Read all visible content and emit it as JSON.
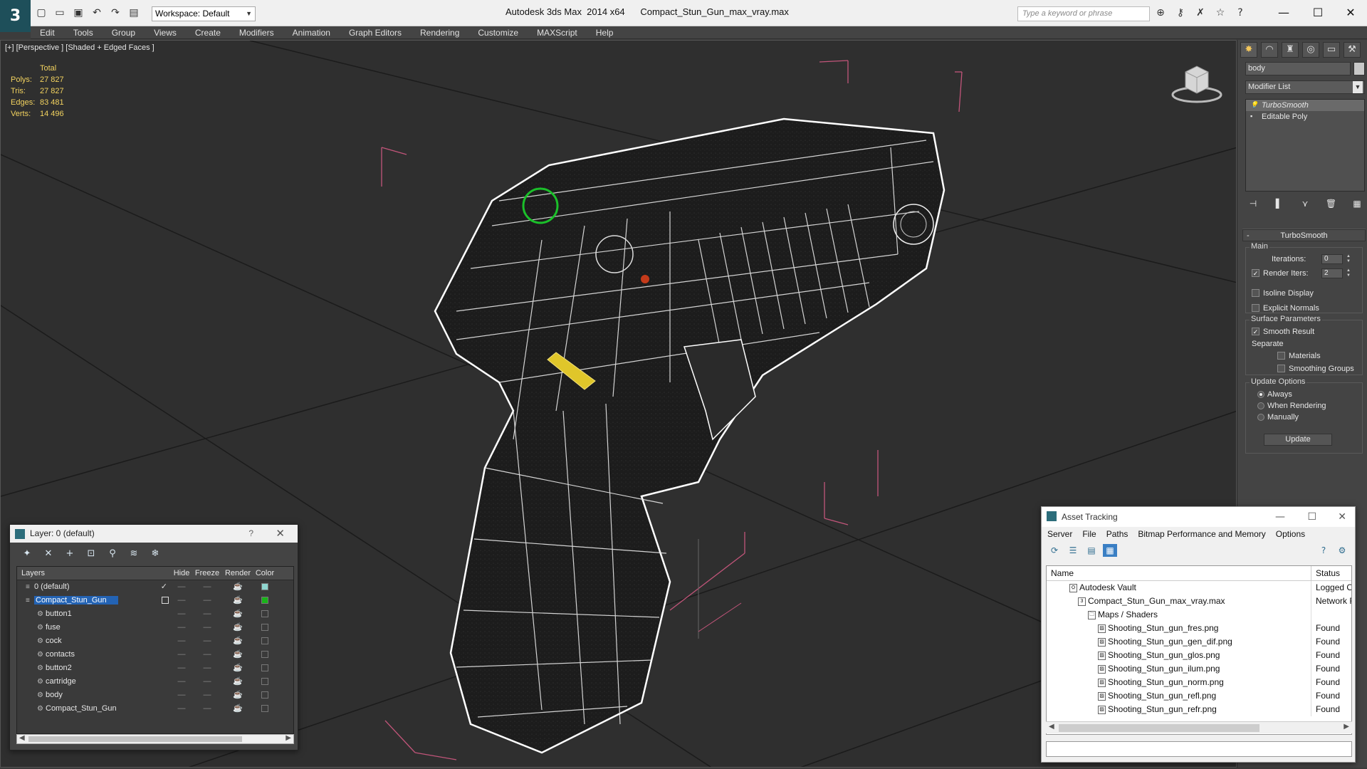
{
  "titlebar": {
    "workspace": "Workspace: Default",
    "app_title": "Autodesk 3ds Max  2014 x64      Compact_Stun_Gun_max_vray.max",
    "search_placeholder": "Type a keyword or phrase",
    "minimize": "—",
    "maximize": "☐",
    "close": "✕"
  },
  "menu": [
    "Edit",
    "Tools",
    "Group",
    "Views",
    "Create",
    "Modifiers",
    "Animation",
    "Graph Editors",
    "Rendering",
    "Customize",
    "MAXScript",
    "Help"
  ],
  "viewport": {
    "label": "[+] [Perspective ] [Shaded + Edged Faces ]",
    "stats_header": "Total",
    "stats": [
      {
        "k": "Polys:",
        "v": "27 827"
      },
      {
        "k": "Tris:",
        "v": "27 827"
      },
      {
        "k": "Edges:",
        "v": "83 481"
      },
      {
        "k": "Verts:",
        "v": "14 496"
      }
    ]
  },
  "command_panel": {
    "object_name": "body",
    "modifier_list": "Modifier List",
    "stack": [
      "TurboSmooth",
      "Editable Poly"
    ],
    "rollout_title": "TurboSmooth",
    "main_group": "Main",
    "iterations_label": "Iterations:",
    "iterations_value": "0",
    "render_iters_label": "Render Iters:",
    "render_iters_value": "2",
    "isoline": "Isoline Display",
    "explicit_normals": "Explicit Normals",
    "surface_group": "Surface Parameters",
    "smooth_result": "Smooth Result",
    "separate": "Separate",
    "materials": "Materials",
    "smoothing_groups": "Smoothing Groups",
    "update_group": "Update Options",
    "always": "Always",
    "when_rendering": "When Rendering",
    "manually": "Manually",
    "update_btn": "Update"
  },
  "layer_dialog": {
    "title": "Layer: 0 (default)",
    "help": "?",
    "close": "✕",
    "columns": {
      "layers": "Layers",
      "hide": "Hide",
      "freeze": "Freeze",
      "render": "Render",
      "color": "Color"
    },
    "rows": [
      {
        "name": "0 (default)",
        "color": "#8fd6d0"
      },
      {
        "name": "Compact_Stun_Gun",
        "color": "#19b419"
      },
      {
        "name": "button1",
        "color": "#3a3a3a"
      },
      {
        "name": "fuse",
        "color": "#3a3a3a"
      },
      {
        "name": "cock",
        "color": "#3a3a3a"
      },
      {
        "name": "contacts",
        "color": "#3a3a3a"
      },
      {
        "name": "button2",
        "color": "#3a3a3a"
      },
      {
        "name": "cartridge",
        "color": "#3a3a3a"
      },
      {
        "name": "body",
        "color": "#3a3a3a"
      },
      {
        "name": "Compact_Stun_Gun",
        "color": "#3a3a3a"
      }
    ]
  },
  "asset_dialog": {
    "title": "Asset Tracking",
    "menu": [
      "Server",
      "File",
      "Paths",
      "Bitmap Performance and Memory",
      "Options"
    ],
    "col_name": "Name",
    "col_status": "Status",
    "rows": [
      {
        "name": "Autodesk Vault",
        "status": "Logged O"
      },
      {
        "name": "Compact_Stun_Gun_max_vray.max",
        "status": "Network F"
      },
      {
        "name": "Maps / Shaders",
        "status": ""
      },
      {
        "name": "Shooting_Stun_gun_fres.png",
        "status": "Found"
      },
      {
        "name": "Shooting_Stun_gun_gen_dif.png",
        "status": "Found"
      },
      {
        "name": "Shooting_Stun_gun_glos.png",
        "status": "Found"
      },
      {
        "name": "Shooting_Stun_gun_ilum.png",
        "status": "Found"
      },
      {
        "name": "Shooting_Stun_gun_norm.png",
        "status": "Found"
      },
      {
        "name": "Shooting_Stun_gun_refl.png",
        "status": "Found"
      },
      {
        "name": "Shooting_Stun_gun_refr.png",
        "status": "Found"
      }
    ]
  }
}
